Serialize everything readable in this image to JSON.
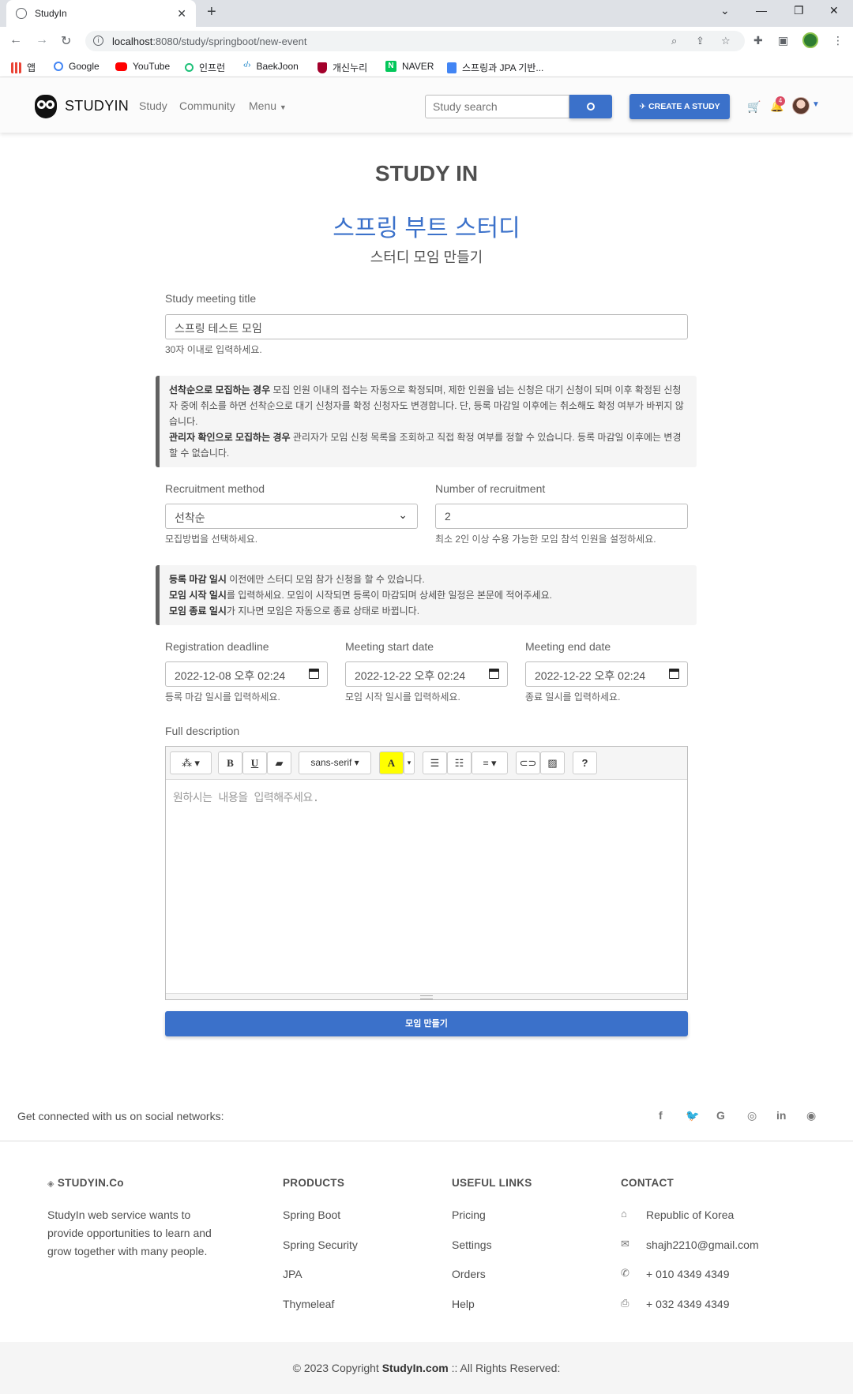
{
  "browser": {
    "tab_title": "StudyIn",
    "url_host": "localhost",
    "url_path": ":8080/study/springboot/new-event",
    "bookmarks": [
      "앱",
      "Google",
      "YouTube",
      "인프런",
      "BaekJoon",
      "개신누리",
      "NAVER",
      "스프링과 JPA 기반..."
    ]
  },
  "navbar": {
    "brand": "STUDYIN",
    "links": [
      "Study",
      "Community",
      "Menu"
    ],
    "search_placeholder": "Study search",
    "create_label": "CREATE A STUDY",
    "notification_count": "4"
  },
  "main": {
    "heading": "STUDY IN",
    "study_title": "스프링 부트 스터디",
    "subtitle": "스터디 모임 만들기"
  },
  "form": {
    "title_label": "Study meeting title",
    "title_value": "스프링 테스트 모임",
    "title_help": "30자 이내로 입력하세요.",
    "notice1": {
      "b1": "선착순으로 모집하는 경우",
      "t1": " 모집 인원 이내의 접수는 자동으로 확정되며, 제한 인원을 넘는 신청은 대기 신청이 되며 이후 확정된 신청자 중에 취소를 하면 선착순으로 대기 신청자를 확정 신청자도 변경합니다. 단, 등록 마감일 이후에는 취소해도 확정 여부가 바뀌지 않습니다.",
      "b2": "관리자 확인으로 모집하는 경우",
      "t2": " 관리자가 모임 신청 목록을 조회하고 직접 확정 여부를 정할 수 있습니다. 등록 마감일 이후에는 변경할 수 없습니다."
    },
    "method_label": "Recruitment method",
    "method_value": "선착순",
    "method_help": "모집방법을 선택하세요.",
    "number_label": "Number of recruitment",
    "number_value": "2",
    "number_help": "최소 2인 이상 수용 가능한 모임 참석 인원을 설정하세요.",
    "notice2": {
      "b1": "등록 마감 일시",
      "t1": " 이전에만 스터디 모임 참가 신청을 할 수 있습니다.",
      "b2": "모임 시작 일시",
      "t2": "를 입력하세요. 모임이 시작되면 등록이 마감되며 상세한 일정은 본문에 적어주세요.",
      "b3": "모임 종료 일시",
      "t3": "가 지나면 모임은 자동으로 종료 상태로 바뀝니다."
    },
    "deadline_label": "Registration deadline",
    "deadline_value": "2022-12-08 오후 02:24",
    "deadline_help": "등록 마감 일시를 입력하세요.",
    "start_label": "Meeting start date",
    "start_value": "2022-12-22 오후 02:24",
    "start_help": "모임 시작 일시를 입력하세요.",
    "end_label": "Meeting end date",
    "end_value": "2022-12-22 오후 02:24",
    "end_help": "종료 일시를 입력하세요.",
    "desc_label": "Full description",
    "font_name": "sans-serif",
    "desc_placeholder": "원하시는 내용을 입력해주세요.",
    "submit_label": "모임 만들기"
  },
  "footer": {
    "social_text": "Get connected with us on social networks:",
    "company_title": "STUDYIN.Co",
    "company_desc": "StudyIn web service wants to provide opportunities to learn and grow together with many people.",
    "products_title": "PRODUCTS",
    "products": [
      "Spring Boot",
      "Spring Security",
      "JPA",
      "Thymeleaf"
    ],
    "links_title": "USEFUL LINKS",
    "links": [
      "Pricing",
      "Settings",
      "Orders",
      "Help"
    ],
    "contact_title": "CONTACT",
    "contact": [
      "Republic of Korea",
      "shajh2210@gmail.com",
      "+ 010 4349 4349",
      "+ 032 4349 4349"
    ],
    "copyright_pre": "© 2023 Copyright ",
    "copyright_brand": "StudyIn.com",
    "copyright_post": " :: All Rights Reserved:"
  },
  "colors": {
    "primary": "#3b71ca",
    "badge": "#dc4c64"
  }
}
